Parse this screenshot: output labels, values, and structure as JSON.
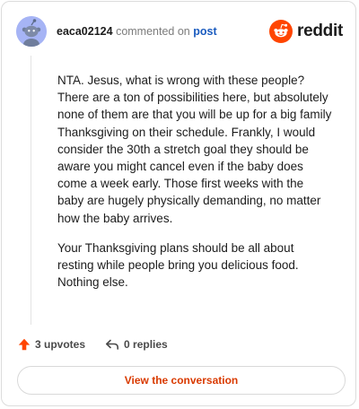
{
  "comment": {
    "author": "eaca02124",
    "action_text": "commented on",
    "post_link_label": "post",
    "paragraphs": [
      "NTA. Jesus, what is wrong with these people? There are a ton of possibilities here, but absolutely none of them are that you will be up for a big family Thanksgiving on their schedule. Frankly, I would consider the 30th a stretch goal they should be aware you might cancel even if the baby does come a week early. Those first weeks with the baby are hugely physically demanding, no matter how the baby arrives.",
      "Your Thanksgiving plans should be all about resting while people bring you delicious food. Nothing else."
    ]
  },
  "brand": {
    "wordmark": "reddit",
    "icon": "reddit-alien-logo",
    "color": "#ff4500"
  },
  "actions": {
    "upvotes_label": "3 upvotes",
    "upvote_icon": "upvote-arrow-icon",
    "upvote_color": "#ff4500",
    "replies_label": "0 replies",
    "reply_icon": "reply-arrow-icon"
  },
  "footer": {
    "view_conversation_label": "View the conversation",
    "accent_color": "#d93a00"
  },
  "avatar": {
    "icon": "snoo-avatar",
    "background": "#a6b4f5"
  }
}
